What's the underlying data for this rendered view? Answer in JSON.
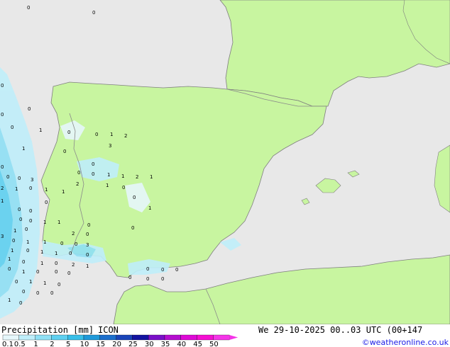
{
  "footer": {
    "title": "Precipitation [mm]",
    "model": "ICON",
    "valid_time": "We 29-10-2025 00..03 UTC (00+147",
    "credit": "©weatheronline.co.uk"
  },
  "legend": {
    "ticks": [
      "0.1",
      "0.5",
      "1",
      "2",
      "5",
      "10",
      "15",
      "20",
      "25",
      "30",
      "35",
      "40",
      "45",
      "50"
    ],
    "colors": [
      "#e6f7fb",
      "#bfeefa",
      "#8fe0f5",
      "#5ed0f0",
      "#38bfe8",
      "#1f99d9",
      "#1c6fcc",
      "#1a44b8",
      "#1414a0",
      "#7a10c8",
      "#b50ecf",
      "#de0ad6",
      "#f50fd2",
      "#f535e8"
    ]
  },
  "colors": {
    "sea": "#e8e8e8",
    "land": "#c8f5a0",
    "coast": "#7f7f7f",
    "border": "#8a8a8a"
  },
  "map": {
    "values": [
      "0",
      "0",
      "0",
      "0",
      "0",
      "0",
      "1",
      "0",
      "0",
      "1",
      "2",
      "3",
      "0",
      "1",
      "0",
      "0",
      "0",
      "1",
      "1",
      "2",
      "1",
      "0",
      "0",
      "0",
      "3",
      "2",
      "1",
      "0",
      "1",
      "1",
      "2",
      "1",
      "0",
      "0",
      "1",
      "0",
      "1",
      "0",
      "0",
      "0",
      "0",
      "1",
      "1",
      "0",
      "0",
      "2",
      "0",
      "3",
      "1",
      "0",
      "0",
      "1",
      "1",
      "0",
      "0",
      "3",
      "1",
      "0",
      "1",
      "1",
      "0",
      "0",
      "1",
      "0",
      "1",
      "0",
      "2",
      "1",
      "0",
      "1",
      "0",
      "0",
      "0",
      "0",
      "1",
      "1",
      "0",
      "0",
      "0",
      "0",
      "1",
      "0",
      "0",
      "0",
      "0",
      "0",
      "0",
      "0"
    ]
  }
}
